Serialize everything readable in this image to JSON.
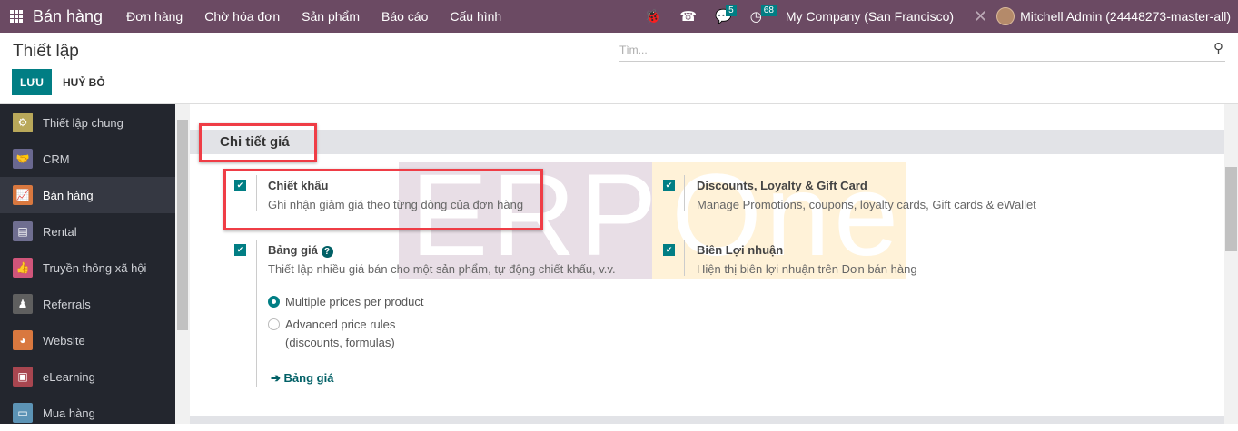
{
  "topbar": {
    "app": "Bán hàng",
    "menu": [
      "Đơn hàng",
      "Chờ hóa đơn",
      "Sản phẩm",
      "Báo cáo",
      "Cấu hình"
    ],
    "messages_count": "5",
    "activities_count": "68",
    "company": "My Company (San Francisco)",
    "user": "Mitchell Admin (24448273-master-all)"
  },
  "control": {
    "title": "Thiết lập",
    "search_placeholder": "Tìm...",
    "save": "LƯU",
    "discard": "HUỶ BỎ"
  },
  "sidebar": {
    "items": [
      {
        "label": "Thiết lập chung",
        "color": "#b9a85a",
        "glyph": "⚙"
      },
      {
        "label": "CRM",
        "color": "#6a6890",
        "glyph": "🤝"
      },
      {
        "label": "Bán hàng",
        "color": "#d9783f",
        "glyph": "📈"
      },
      {
        "label": "Rental",
        "color": "#6f6e90",
        "glyph": "▤"
      },
      {
        "label": "Truyền thông xã hội",
        "color": "#d0557a",
        "glyph": "👍"
      },
      {
        "label": "Referrals",
        "color": "#5f5f5f",
        "glyph": "♟"
      },
      {
        "label": "Website",
        "color": "#d9783f",
        "glyph": "◕"
      },
      {
        "label": "eLearning",
        "color": "#a84650",
        "glyph": "▣"
      },
      {
        "label": "Mua hàng",
        "color": "#5c93b5",
        "glyph": "▭"
      }
    ]
  },
  "section": {
    "title": "Chi tiết giá",
    "settings": [
      {
        "title": "Chiết khấu",
        "desc": "Ghi nhận giảm giá theo từng dòng của đơn hàng",
        "checked": true
      },
      {
        "title": "Discounts, Loyalty & Gift Card",
        "desc": "Manage Promotions, coupons, loyalty cards, Gift cards & eWallet",
        "checked": true
      },
      {
        "title": "Bảng giá",
        "desc": "Thiết lập nhiều giá bán cho một sản phẩm, tự động chiết khấu, v.v.",
        "checked": true
      },
      {
        "title": "Biên Lợi nhuận",
        "desc": "Hiện thị biên lợi nhuận trên Đơn bán hàng",
        "checked": true
      }
    ],
    "pricelist_options": [
      "Multiple prices per product",
      "Advanced price rules",
      "(discounts, formulas)"
    ],
    "pricelist_link": "Bảng giá"
  },
  "watermark": {
    "text1": "ERP",
    "text2": "One"
  }
}
